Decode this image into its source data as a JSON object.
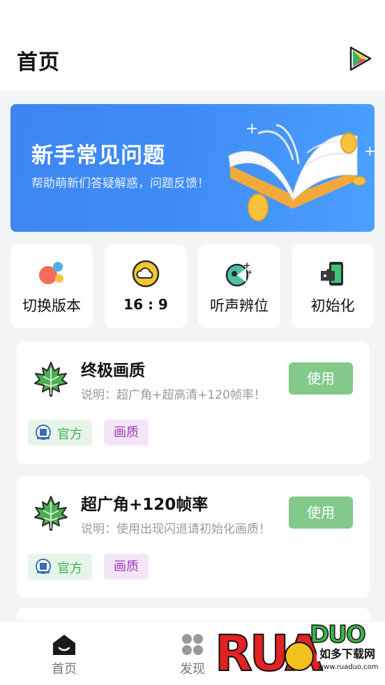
{
  "header": {
    "title": "首页"
  },
  "banner": {
    "title": "新手常见问题",
    "subtitle": "帮助萌新们答疑解惑，问题反馈！"
  },
  "quick_actions": [
    {
      "label": "切换版本",
      "icon": "color-dots-icon"
    },
    {
      "label": "16 : 9",
      "icon": "cloud-icon"
    },
    {
      "label": "听声辨位",
      "icon": "sound-icon"
    },
    {
      "label": "初始化",
      "icon": "puzzle-icon"
    }
  ],
  "presets": [
    {
      "title": "终极画质",
      "description": "说明：超广角+超高清+120帧率！",
      "button": "使用",
      "tags": [
        "官方",
        "画质"
      ]
    },
    {
      "title": "超广角+120帧率",
      "description": "说明：使用出现闪退请初始化画质！",
      "button": "使用",
      "tags": [
        "官方",
        "画质"
      ]
    }
  ],
  "nav": [
    {
      "label": "首页",
      "icon": "home-icon"
    },
    {
      "label": "发现",
      "icon": "grid-icon"
    }
  ],
  "watermark": {
    "main": "RUANDUO",
    "sub": "如多下载网",
    "url": "www.ruaduo.com"
  },
  "colors": {
    "use_button": "#84c98c",
    "tag_official": "#3fae52",
    "tag_quality": "#9c3fb3",
    "banner": "#3f8bf6"
  }
}
